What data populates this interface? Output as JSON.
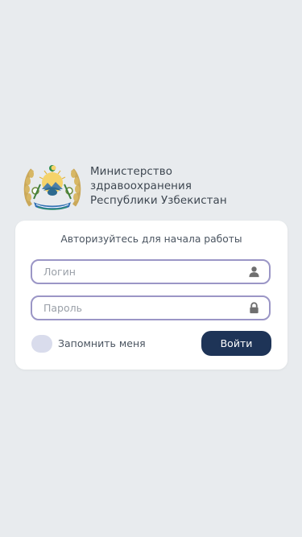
{
  "header": {
    "org_line_1": "Министерство",
    "org_line_2": "здравоохранения",
    "org_line_3": "Республики Узбекистан",
    "emblem_icon": "uzbekistan-state-emblem"
  },
  "login_form": {
    "title": "Авторизуйтесь для начала работы",
    "login_placeholder": "Логин",
    "login_value": "",
    "login_icon": "user-icon",
    "password_placeholder": "Пароль",
    "password_value": "",
    "password_icon": "lock-icon",
    "remember_label": "Запомнить меня",
    "remember_checked": false,
    "submit_label": "Войти"
  },
  "colors": {
    "background": "#e8ebee",
    "card": "#ffffff",
    "field_border": "#9b96c6",
    "button": "#1e3457",
    "checkbox": "#d9dcec"
  }
}
